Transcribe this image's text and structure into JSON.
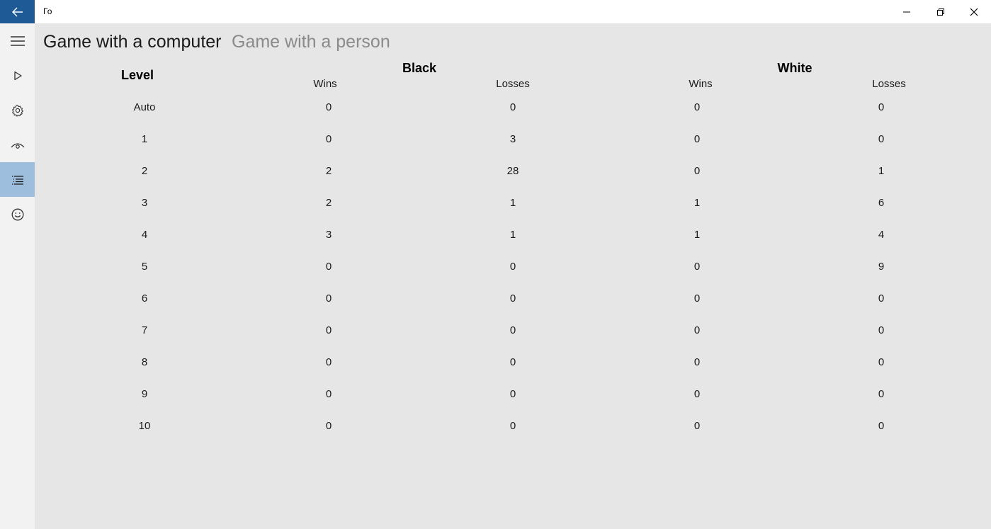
{
  "window": {
    "title": "Го"
  },
  "sidebar": {
    "items": [
      {
        "icon": "hamburger-menu-icon"
      },
      {
        "icon": "play-icon"
      },
      {
        "icon": "gear-icon"
      },
      {
        "icon": "eye-icon"
      },
      {
        "icon": "list-icon",
        "selected": true
      },
      {
        "icon": "smiley-icon"
      }
    ]
  },
  "tabs": [
    {
      "label": "Game with a computer",
      "active": true
    },
    {
      "label": "Game with a person",
      "active": false
    }
  ],
  "table": {
    "level_header": "Level",
    "black_header": "Black",
    "white_header": "White",
    "wins_label": "Wins",
    "losses_label": "Losses",
    "rows": [
      {
        "level": "Auto",
        "black_wins": "0",
        "black_losses": "0",
        "white_wins": "0",
        "white_losses": "0"
      },
      {
        "level": "1",
        "black_wins": "0",
        "black_losses": "3",
        "white_wins": "0",
        "white_losses": "0"
      },
      {
        "level": "2",
        "black_wins": "2",
        "black_losses": "28",
        "white_wins": "0",
        "white_losses": "1"
      },
      {
        "level": "3",
        "black_wins": "2",
        "black_losses": "1",
        "white_wins": "1",
        "white_losses": "6"
      },
      {
        "level": "4",
        "black_wins": "3",
        "black_losses": "1",
        "white_wins": "1",
        "white_losses": "4"
      },
      {
        "level": "5",
        "black_wins": "0",
        "black_losses": "0",
        "white_wins": "0",
        "white_losses": "9"
      },
      {
        "level": "6",
        "black_wins": "0",
        "black_losses": "0",
        "white_wins": "0",
        "white_losses": "0"
      },
      {
        "level": "7",
        "black_wins": "0",
        "black_losses": "0",
        "white_wins": "0",
        "white_losses": "0"
      },
      {
        "level": "8",
        "black_wins": "0",
        "black_losses": "0",
        "white_wins": "0",
        "white_losses": "0"
      },
      {
        "level": "9",
        "black_wins": "0",
        "black_losses": "0",
        "white_wins": "0",
        "white_losses": "0"
      },
      {
        "level": "10",
        "black_wins": "0",
        "black_losses": "0",
        "white_wins": "0",
        "white_losses": "0"
      }
    ]
  },
  "colors": {
    "accent": "#1e5a96",
    "selected_nav": "#9dbedc",
    "content_bg": "#e6e6e6",
    "sidebar_bg": "#f2f2f2"
  }
}
